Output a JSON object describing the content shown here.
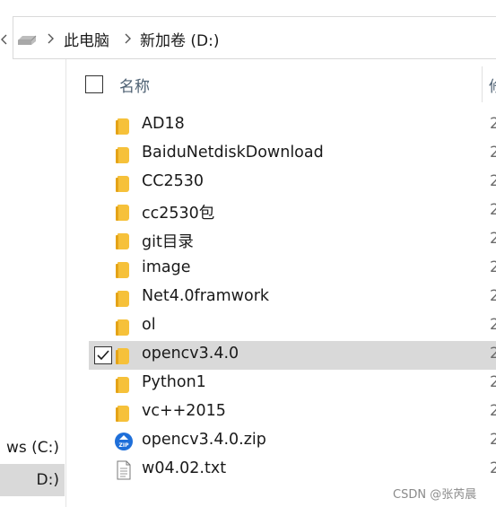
{
  "address": {
    "crumbs": [
      "此电脑",
      "新加卷 (D:)"
    ],
    "drive_icon": "drive-icon"
  },
  "nav": {
    "items": [
      {
        "label": "ws (C:)",
        "selected": false
      },
      {
        "label": "D:)",
        "selected": true
      }
    ]
  },
  "header": {
    "name_label": "名称",
    "next_label": "修"
  },
  "files": [
    {
      "name": "AD18",
      "type": "folder",
      "date": "2",
      "checked": false
    },
    {
      "name": "BaiduNetdiskDownload",
      "type": "folder",
      "date": "2",
      "checked": false
    },
    {
      "name": "CC2530",
      "type": "folder",
      "date": "2",
      "checked": false
    },
    {
      "name": "cc2530包",
      "type": "folder",
      "date": "2",
      "checked": false
    },
    {
      "name": "git目录",
      "type": "folder",
      "date": "2",
      "checked": false
    },
    {
      "name": "image",
      "type": "folder",
      "date": "2",
      "checked": false
    },
    {
      "name": "Net4.0framwork",
      "type": "folder",
      "date": "2",
      "checked": false
    },
    {
      "name": "ol",
      "type": "folder",
      "date": "2",
      "checked": false
    },
    {
      "name": "opencv3.4.0",
      "type": "folder",
      "date": "2",
      "checked": true
    },
    {
      "name": "Python1",
      "type": "folder",
      "date": "2",
      "checked": false
    },
    {
      "name": "vc++2015",
      "type": "folder",
      "date": "2",
      "checked": false
    },
    {
      "name": "opencv3.4.0.zip",
      "type": "zip",
      "date": "2",
      "checked": false
    },
    {
      "name": "w04.02.txt",
      "type": "txt",
      "date": "2",
      "checked": false
    }
  ],
  "colors": {
    "folder": "#f6c13a",
    "selection": "#d9d9d9",
    "zip_blue": "#1e6fd9"
  },
  "watermark": "CSDN @张芮晨"
}
